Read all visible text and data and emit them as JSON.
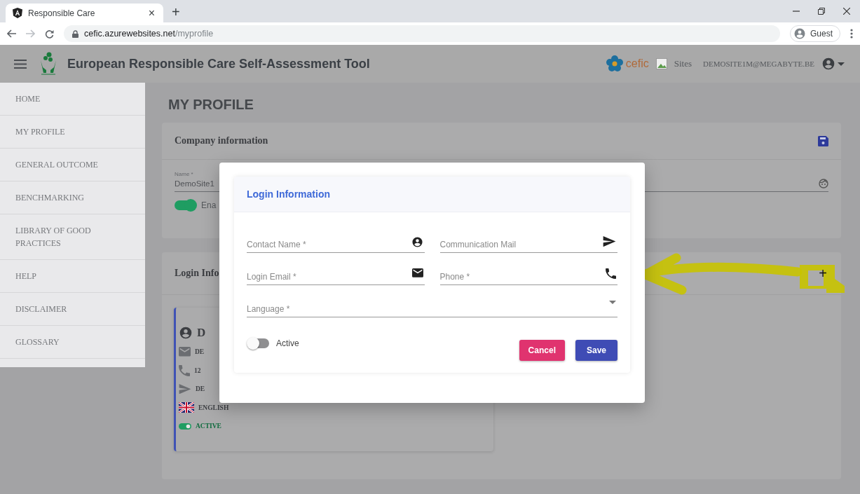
{
  "browser": {
    "tab_title": "Responsible Care",
    "tab_close": "×",
    "new_tab": "+",
    "url_host": "cefic.azurewebsites.net",
    "url_path": "/myprofile",
    "profile": "Guest"
  },
  "header": {
    "title": "European Responsible Care Self-Assessment Tool",
    "brand": "cefic",
    "sites": "Sites",
    "user_email": "DEMOSITE1M@MEGABYTE.BE"
  },
  "sidebar": {
    "items": [
      {
        "label": "HOME",
        "selected": false
      },
      {
        "label": "MY PROFILE",
        "selected": false
      },
      {
        "label": "GENERAL OUTCOME",
        "selected": false
      },
      {
        "label": "BENCHMARKING",
        "selected": false
      },
      {
        "label": "LIBRARY OF GOOD PRACTICES",
        "selected": false
      },
      {
        "label": "HELP",
        "selected": false
      },
      {
        "label": "DISCLAIMER",
        "selected": false
      },
      {
        "label": "GLOSSARY",
        "selected": false
      }
    ]
  },
  "page": {
    "heading": "MY PROFILE"
  },
  "company_card": {
    "title": "Company information",
    "name_field": {
      "label": "Name *",
      "value": "DemoSite1"
    },
    "enabled_toggle": {
      "label": "Ena",
      "on": true
    }
  },
  "login_card": {
    "title": "Login Info",
    "add": "+",
    "contact": {
      "name": "D",
      "email": "DE",
      "phone": "12",
      "mail": "DE",
      "language": "ENGLISH",
      "status": "ACTIVE",
      "active": true
    }
  },
  "dialog": {
    "title": "Login Information",
    "fields": [
      {
        "kind": "contact",
        "placeholder": "Contact Name *"
      },
      {
        "kind": "mail",
        "placeholder": "Communication Mail"
      },
      {
        "kind": "email",
        "placeholder": "Login Email *"
      },
      {
        "kind": "phone",
        "placeholder": "Phone *"
      },
      {
        "kind": "select",
        "placeholder": "Language *"
      }
    ],
    "active_toggle": {
      "label": "Active",
      "on": false
    },
    "buttons": [
      {
        "kind": "cancel",
        "label": "Cancel"
      },
      {
        "kind": "save",
        "label": "Save"
      }
    ]
  }
}
